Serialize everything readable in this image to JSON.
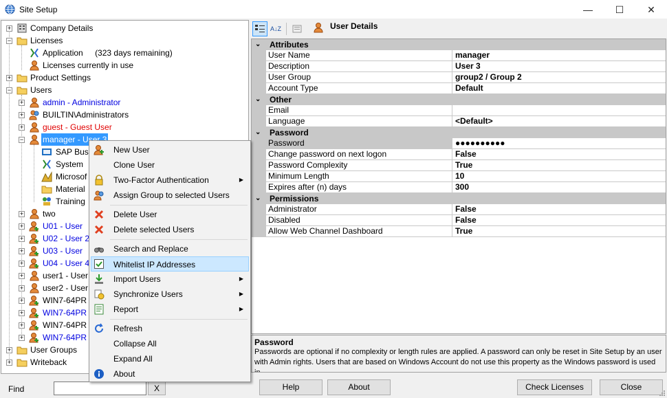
{
  "window": {
    "title": "Site Setup",
    "minimize": "—",
    "maximize": "☐",
    "close": "✕"
  },
  "tree": {
    "company_details": "Company Details",
    "licenses": "Licenses",
    "application": "Application",
    "application_days": "(323 days remaining)",
    "licenses_in_use": "Licenses currently in use",
    "product_settings": "Product Settings",
    "users": "Users",
    "user_admin": "admin - Administrator",
    "user_builtin": "BUILTIN\\Administrators",
    "user_guest": "guest - Guest User",
    "user_manager": "manager - User 3",
    "child_sap": "SAP Bus",
    "child_system": "System",
    "child_microsoft": "Microsof",
    "child_material": "Material",
    "child_training": "Training",
    "user_two": "two",
    "user_u01": "U01 - User",
    "user_u02": "U02 - User 2",
    "user_u03": "U03 - User",
    "user_u04": "U04 - User 4",
    "user_user1": "user1 - User",
    "user_user2": "user2 - User",
    "user_win1": "WIN7-64PR",
    "user_win2": "WIN7-64PR",
    "user_win3": "WIN7-64PR",
    "user_win4": "WIN7-64PR",
    "user_groups": "User Groups",
    "writeback": "Writeback"
  },
  "find": {
    "label": "Find",
    "value": "",
    "clear": "X"
  },
  "buttons": {
    "help": "Help",
    "about": "About",
    "check_licenses": "Check Licenses",
    "close": "Close"
  },
  "propgrid": {
    "title": "User Details",
    "toolbar_sort": "A↓Z",
    "categories": {
      "attributes": "Attributes",
      "other": "Other",
      "password": "Password",
      "permissions": "Permissions"
    },
    "rows": [
      {
        "name": "User Name",
        "value": "manager"
      },
      {
        "name": "Description",
        "value": "User 3"
      },
      {
        "name": "User Group",
        "value": "group2 / Group 2"
      },
      {
        "name": "Account Type",
        "value": "Default"
      },
      {
        "name": "Email",
        "value": ""
      },
      {
        "name": "Language",
        "value": "<Default>"
      },
      {
        "name": "Password",
        "value": "●●●●●●●●●●"
      },
      {
        "name": "Change password on next logon",
        "value": "False"
      },
      {
        "name": "Password Complexity",
        "value": "True"
      },
      {
        "name": "Minimum Length",
        "value": "10"
      },
      {
        "name": "Expires after (n) days",
        "value": "300"
      },
      {
        "name": "Administrator",
        "value": "False"
      },
      {
        "name": "Disabled",
        "value": "False"
      },
      {
        "name": "Allow Web Channel Dashboard",
        "value": "True"
      }
    ]
  },
  "help_panel": {
    "title": "Password",
    "description": "Passwords are optional if no complexity or length rules are applied.  A password can only be reset in Site Setup by an user with Admin rights.  Users that are based on Windows Account do not use this property as the Windows password is used in..."
  },
  "context_menu": {
    "new_user": "New User",
    "clone_user": "Clone User",
    "two_factor": "Two-Factor Authentication",
    "assign_group": "Assign Group to selected Users",
    "delete_user": "Delete User",
    "delete_selected": "Delete selected Users",
    "search_replace": "Search and Replace",
    "whitelist_ip": "Whitelist IP Addresses",
    "import_users": "Import Users",
    "sync_users": "Synchronize Users",
    "report": "Report",
    "refresh": "Refresh",
    "collapse_all": "Collapse All",
    "expand_all": "Expand All",
    "about": "About",
    "submenu_arrow": "▶"
  },
  "colors": {
    "selection": "#3399ff",
    "menu_highlight": "#cce8ff",
    "link_blue": "#0000e0",
    "guest_red": "#e00000",
    "grid_category": "#c8c8c8"
  }
}
